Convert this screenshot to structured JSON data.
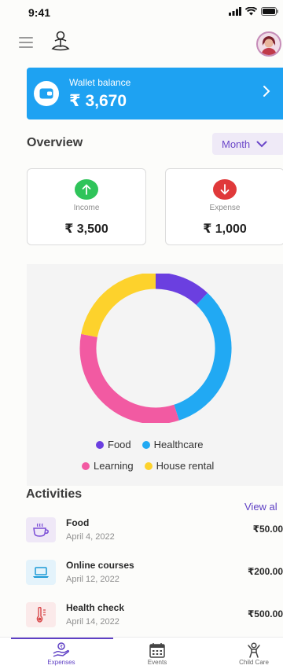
{
  "status_bar": {
    "time": "9:41"
  },
  "wallet": {
    "label": "Wallet balance",
    "amount": "₹ 3,670"
  },
  "overview": {
    "title": "Overview",
    "period": "Month"
  },
  "income": {
    "label": "Income",
    "amount": "₹ 3,500"
  },
  "expense": {
    "label": "Expense",
    "amount": "₹ 1,000"
  },
  "chart_data": {
    "type": "pie",
    "title": "",
    "categories": [
      "Food",
      "Healthcare",
      "Learning",
      "House rental"
    ],
    "values": [
      12,
      33,
      33,
      22
    ],
    "colors": [
      "#6b3fe0",
      "#21a9f3",
      "#f25aa2",
      "#fdd22c"
    ]
  },
  "legend": {
    "food": "Food",
    "healthcare": "Healthcare",
    "learning": "Learning",
    "house_rental": "House rental"
  },
  "activities": {
    "title": "Activities",
    "view_all": "View al",
    "items": [
      {
        "name": "Food",
        "date": "April 4, 2022",
        "amount": "₹50.00",
        "icon": "cup-icon"
      },
      {
        "name": "Online courses",
        "date": "April 12, 2022",
        "amount": "₹200.00",
        "icon": "laptop-icon"
      },
      {
        "name": "Health check",
        "date": "April 14, 2022",
        "amount": "₹500.00",
        "icon": "thermometer-icon"
      }
    ]
  },
  "nav": {
    "expenses": "Expenses",
    "events": "Events",
    "child_care": "Child Care"
  },
  "colors": {
    "accent": "#5e3fc4",
    "wallet_blue": "#1ea2f2",
    "income_green": "#2fc45a",
    "expense_red": "#e0393a"
  }
}
